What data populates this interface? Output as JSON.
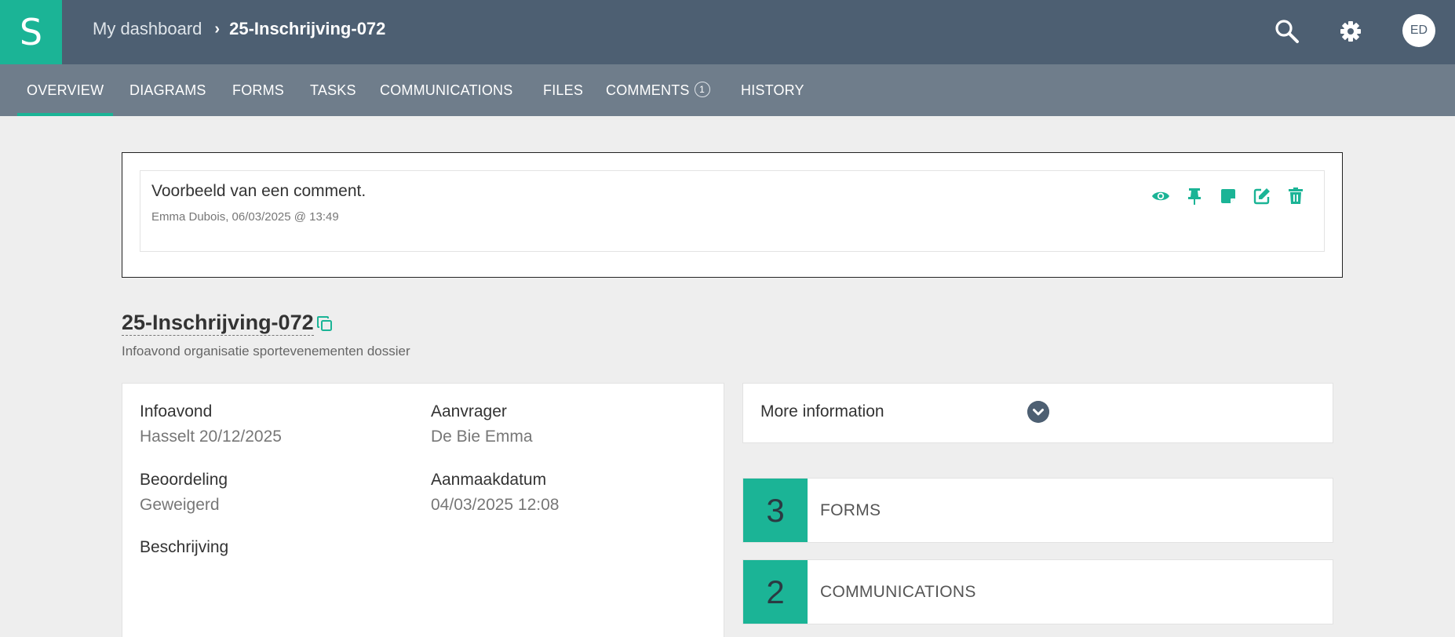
{
  "header": {
    "logo_letter": "S",
    "breadcrumb_home": "My dashboard",
    "breadcrumb_current": "25-Inschrijving-072",
    "avatar_initials": "ED",
    "icons": [
      "search-icon",
      "gear-icon"
    ],
    "colors": {
      "header_bg": "#4d5f72",
      "accent": "#1bb496",
      "tabbar_bg": "#6f7d8b"
    }
  },
  "tabs": [
    {
      "label": "OVERVIEW",
      "active": true
    },
    {
      "label": "DIAGRAMS"
    },
    {
      "label": "FORMS"
    },
    {
      "label": "TASKS"
    },
    {
      "label": "COMMUNICATIONS"
    },
    {
      "label": "FILES"
    },
    {
      "label": "COMMENTS",
      "badge": "1"
    },
    {
      "label": "HISTORY"
    }
  ],
  "comment": {
    "text": "Voorbeeld van een comment.",
    "meta": "Emma Dubois, 06/03/2025 @ 13:49",
    "actions": [
      "eye-icon",
      "pin-icon",
      "note-icon",
      "edit-icon",
      "trash-icon"
    ]
  },
  "case": {
    "title": "25-Inschrijving-072",
    "subtitle": "Infoavond organisatie sportevenementen dossier"
  },
  "details": {
    "infoavond": {
      "label": "Infoavond",
      "value": "Hasselt 20/12/2025"
    },
    "aanvrager": {
      "label": "Aanvrager",
      "value": "De Bie Emma"
    },
    "beoordeling": {
      "label": "Beoordeling",
      "value": "Geweigerd"
    },
    "aanmaakdatum": {
      "label": "Aanmaakdatum",
      "value": "04/03/2025 12:08"
    },
    "beschrijving": {
      "label": "Beschrijving"
    }
  },
  "more_info": {
    "label": "More information"
  },
  "counters": [
    {
      "count": "3",
      "label": "FORMS"
    },
    {
      "count": "2",
      "label": "COMMUNICATIONS"
    }
  ]
}
